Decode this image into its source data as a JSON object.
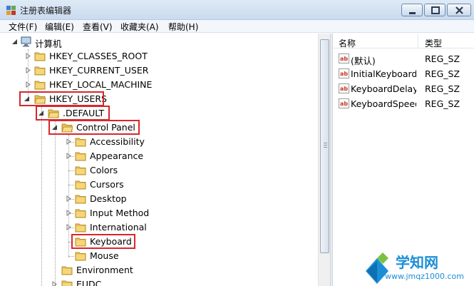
{
  "window": {
    "title": "注册表编辑器",
    "buttons": [
      "minimize-icon",
      "maximize-icon",
      "close-icon"
    ]
  },
  "menu": [
    "文件(F)",
    "编辑(E)",
    "查看(V)",
    "收藏夹(A)",
    "帮助(H)"
  ],
  "tree": {
    "root": "计算机",
    "hives": [
      "HKEY_CLASSES_ROOT",
      "HKEY_CURRENT_USER",
      "HKEY_LOCAL_MACHINE",
      "HKEY_USERS"
    ],
    "default": ".DEFAULT",
    "control_panel": "Control Panel",
    "control_panel_children": [
      "Accessibility",
      "Appearance",
      "Colors",
      "Cursors",
      "Desktop",
      "Input Method",
      "International",
      "Keyboard",
      "Mouse"
    ],
    "more": [
      "Environment",
      "EUDC"
    ]
  },
  "values_pane": {
    "columns": [
      "名称",
      "类型"
    ],
    "rows": [
      {
        "name": "(默认)",
        "type": "REG_SZ"
      },
      {
        "name": "InitialKeyboardIndicators",
        "type": "REG_SZ"
      },
      {
        "name": "KeyboardDelay",
        "type": "REG_SZ"
      },
      {
        "name": "KeyboardSpeed",
        "type": "REG_SZ"
      }
    ]
  },
  "watermark": {
    "brand": "学知网",
    "url": "www.jmqz1000.com"
  },
  "colors": {
    "highlight_box": "#d9262b",
    "folder": "#e8c15a",
    "titlebar": "#c9dbef",
    "watermark": "#1b8fd6"
  }
}
